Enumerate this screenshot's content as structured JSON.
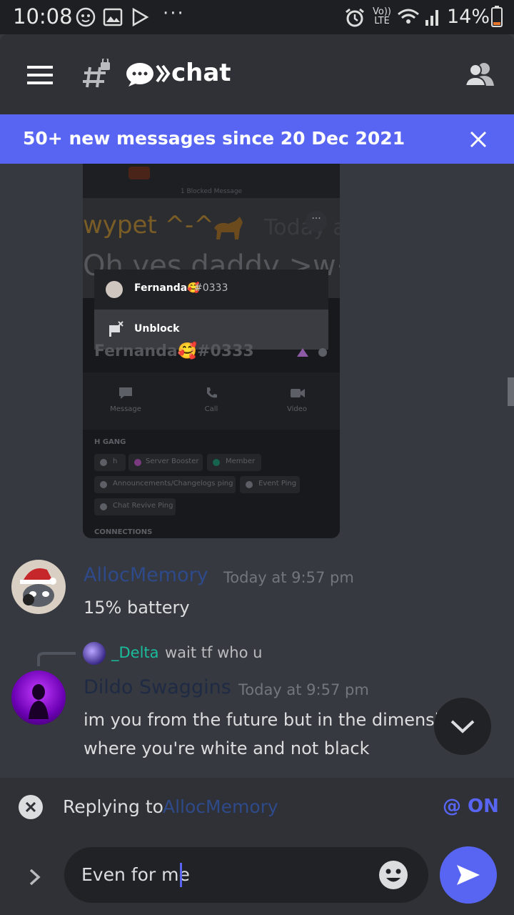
{
  "status": {
    "time": "10:08",
    "network": "Vo)) LTE",
    "battery": "14%"
  },
  "header": {
    "channel_name": "chat"
  },
  "banner": {
    "text": "50+ new messages since 20 Dec 2021"
  },
  "screenshot": {
    "blocked_label": "1 Blocked Message",
    "name_behind": "wypet ^-^",
    "time_behind": "Today a",
    "text_behind": "Oh yes daddy >w<",
    "popup_user": "Fernanda🥰",
    "popup_tag": "#0333",
    "popup_action": "Unblock",
    "profile_name": "Fernanda🥰#0333",
    "actions": [
      "Message",
      "Call",
      "Video"
    ],
    "server_name": "H GANG",
    "roles": [
      {
        "name": "h",
        "color": "#b9bbbe"
      },
      {
        "name": "Server Booster",
        "color": "#f47fff"
      },
      {
        "name": "Member",
        "color": "#1abc9c"
      },
      {
        "name": "Announcements/Changelogs ping",
        "color": "#b9bbbe"
      },
      {
        "name": "Event Ping",
        "color": "#b9bbbe"
      },
      {
        "name": "Chat Revive Ping",
        "color": "#b9bbbe"
      }
    ],
    "connections_label": "CONNECTIONS"
  },
  "messages": [
    {
      "author": "AllocMemory",
      "author_color": "#2e4a8a",
      "time": "Today at 9:57 pm",
      "lines": [
        "15% battery"
      ]
    },
    {
      "reply_user": "_Delta",
      "reply_color": "#1abc9c",
      "reply_text": "wait tf who u",
      "author": "Dildo Swaggins",
      "author_color": "#1f2a44",
      "time": "Today at 9:57 pm",
      "lines": [
        "im you from the future but in the dimensio",
        "where you're white and not black"
      ]
    }
  ],
  "reply": {
    "prefix": "Replying to ",
    "target": "AllocMemory",
    "mention_label": "@ ON"
  },
  "composer": {
    "value": "Even for me"
  },
  "colors": {
    "accent": "#5865f2"
  }
}
